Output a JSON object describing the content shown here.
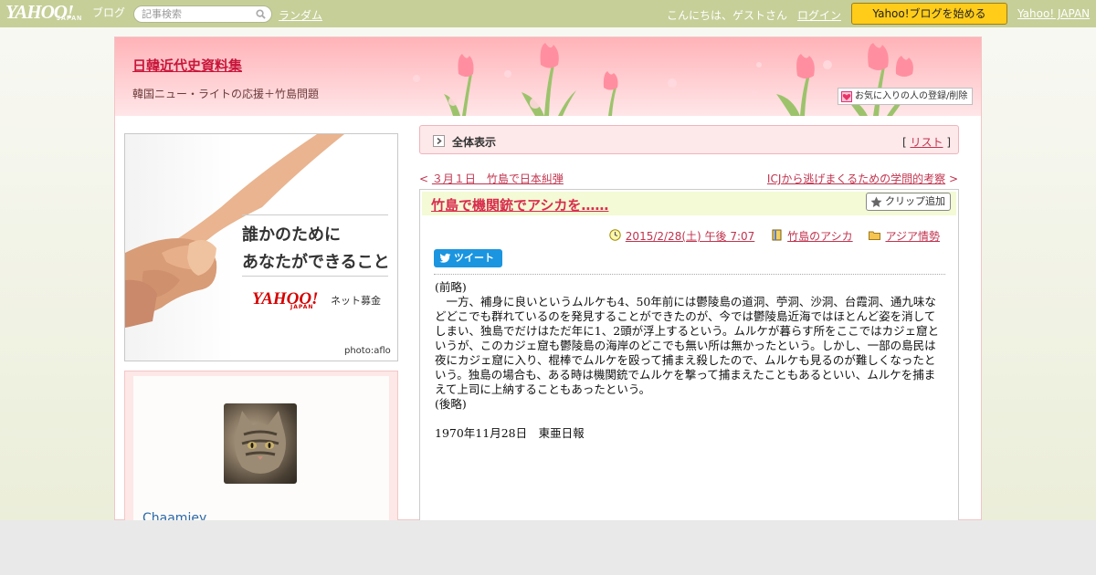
{
  "topbar": {
    "logo_main": "YAHOO!",
    "logo_sub": "JAPAN",
    "logo_blog": "ブログ",
    "search_placeholder": "記事検索",
    "random": "ランダム",
    "greeting": "こんにちは、ゲストさん",
    "login": "ログイン",
    "start_button": "Yahoo!ブログを始める",
    "yahoo_japan": "Yahoo! JAPAN"
  },
  "header": {
    "title": "日韓近代史資料集",
    "description": "韓国ニュー・ライトの応援＋竹島問題",
    "favorite_button": "お気に入りの人の登録/削除"
  },
  "ad": {
    "line1": "誰かのために",
    "line2": "あなたができること",
    "brand": "YAHOO!",
    "brand_sub": "JAPAN",
    "service": "ネット募金",
    "credit": "photo:aflo"
  },
  "profile": {
    "username": "Chaamiey"
  },
  "viewbar": {
    "title": "全体表示",
    "list_label": "リスト"
  },
  "nav": {
    "prev": "３月１日　竹島で日本糾弾",
    "next": "ICJから逃げまくるための学問的考察"
  },
  "article": {
    "title": "竹島で機関銃でアシカを‥‥‥",
    "clip_button": "クリップ追加",
    "datetime": "2015/2/28(土) 午後 7:07",
    "category": "竹島のアシカ",
    "folder": "アジア情勢",
    "tweet": "ツイート",
    "paragraphs": [
      "(前略)",
      "　一方、補身に良いというムルケも4、50年前には鬱陵島の道洞、苧洞、沙洞、台霞洞、通九味などどこでも群れているのを発見することができたのが、今では鬱陵島近海ではほとんど姿を消してしまい、独島でだけはただ年に1、2頭が浮上するという。ムルケが暮らす所をここではカジェ窟というが、このカジェ窟も鬱陵島の海岸のどこでも無い所は無かったという。しかし、一部の島民は夜にカジェ窟に入り、棍棒でムルケを殴って捕まえ殺したので、ムルケも見るのが難しくなったという。独島の場合も、ある時は機関銃でムルケを撃って捕まえたこともあるといい、ムルケを捕まえて上司に上納することもあったという。",
      "(後略)",
      "",
      "1970年11月28日　東亜日報"
    ]
  },
  "icons": {
    "search": "search-icon",
    "favorite": "heart-icon",
    "viewbar": "arrow-right-icon",
    "clip": "star-icon",
    "datetime": "clock-icon",
    "category": "book-icon",
    "folder": "folder-icon",
    "tweet": "bird-icon"
  },
  "colors": {
    "topbar": "#c6cf98",
    "accent": "#c0334e",
    "title": "#d92c4d",
    "start_button": "#ffcc1a",
    "tweet": "#1b95e0"
  }
}
